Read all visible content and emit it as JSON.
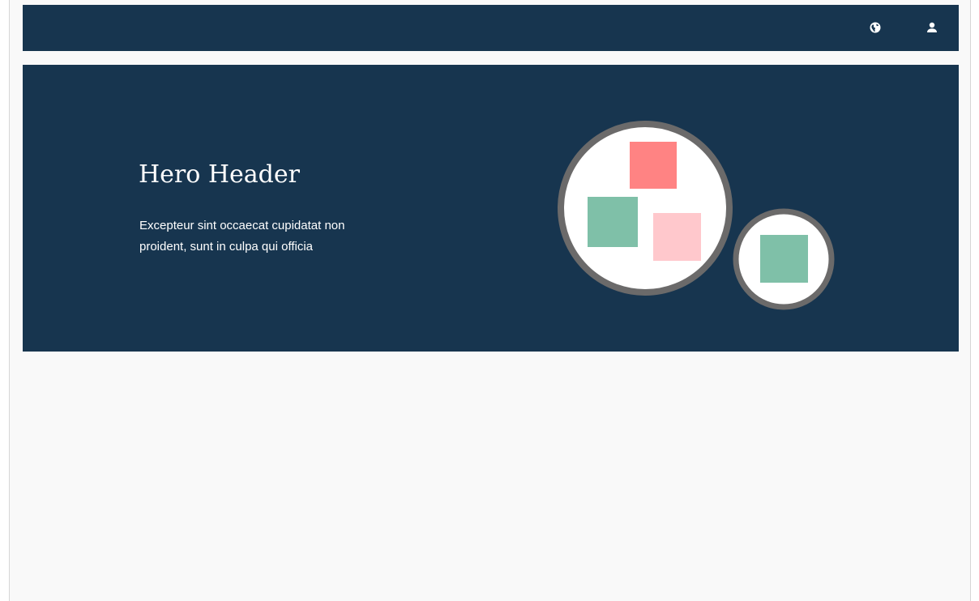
{
  "navbar": {
    "background": "#17354f",
    "icons": [
      {
        "name": "globe-icon"
      },
      {
        "name": "user-icon"
      }
    ]
  },
  "hero": {
    "background": "#17354f",
    "title": "Hero Header",
    "text": "Excepteur sint occaecat cupidatat non proident, sunt in culpa qui officia"
  },
  "illustration": {
    "circle_fill": "#ffffff",
    "circle_stroke": "#6b6a6a",
    "colors": {
      "coral": "#ff8383",
      "pink": "#ffc8cc",
      "green": "#7fc0a8"
    }
  }
}
